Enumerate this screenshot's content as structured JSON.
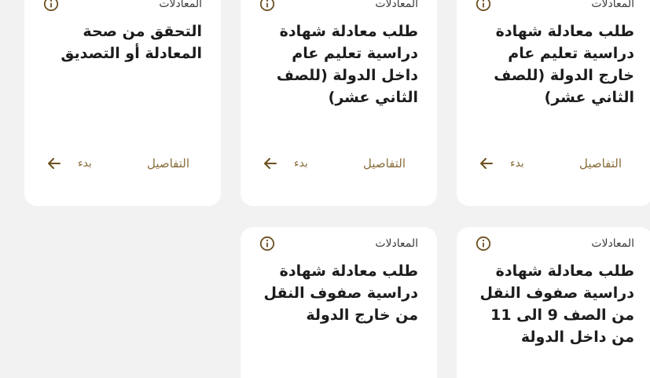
{
  "cards": [
    {
      "category": "المعادلات",
      "title": "طلب معادلة شهادة دراسية تعليم عام خارج الدولة (للصف الثاني عشر)",
      "details_label": "التفاصيل",
      "start_label": "بدء"
    },
    {
      "category": "المعادلات",
      "title": "طلب معادلة شهادة دراسية تعليم عام داخل الدولة (للصف الثاني عشر)",
      "details_label": "التفاصيل",
      "start_label": "بدء"
    },
    {
      "category": "المعادلات",
      "title": "التحقق من صحة المعادلة أو التصديق",
      "details_label": "التفاصيل",
      "start_label": "بدء"
    },
    {
      "category": "المعادلات",
      "title": "طلب معادلة شهادة دراسية صفوف النقل من الصف 9 الى 11 من داخل الدولة"
    },
    {
      "category": "المعادلات",
      "title": "طلب معادلة شهادة دراسية صفوف النقل من خارج الدولة"
    }
  ],
  "colors": {
    "accent": "#8a6d3b",
    "icon": "#6b4f1f",
    "title": "#1c1c1c",
    "background": "#f2f2f2",
    "card": "#ffffff"
  },
  "icons": {
    "info": "info-circle-icon",
    "start": "arrow-left-icon"
  }
}
